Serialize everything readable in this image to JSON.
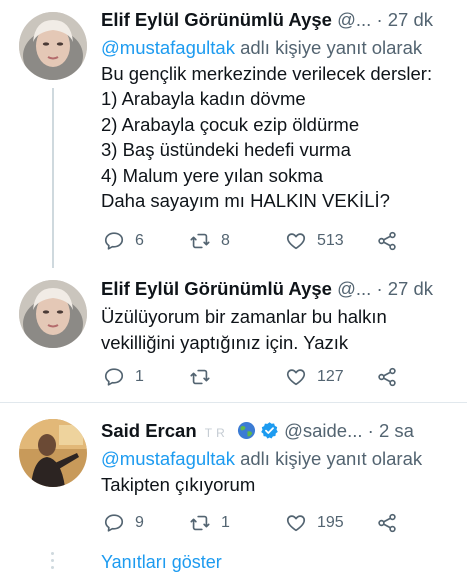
{
  "tweets": [
    {
      "name": "Elif Eylül Görünümlü Ayşe",
      "handle": "@...",
      "dot": "·",
      "time": "27 dk",
      "reply_prefix": "@mustafagultak",
      "reply_suffix": " adlı kişiye yanıt olarak",
      "lines": [
        "Bu gençlik merkezinde verilecek dersler:",
        "1) Arabayla kadın dövme",
        "2) Arabayla çocuk ezip öldürme",
        "3) Baş üstündeki hedefi vurma",
        "4) Malum yere yılan sokma",
        "Daha sayayım mı HALKIN VEKİLİ?"
      ],
      "replies": "6",
      "retweets": "8",
      "likes": "513"
    },
    {
      "name": "Elif Eylül Görünümlü Ayşe",
      "handle": "@...",
      "dot": "·",
      "time": "27 dk",
      "lines": [
        "Üzülüyorum bir zamanlar bu halkın",
        "vekilliğini yaptığınız için. Yazık"
      ],
      "replies": "1",
      "retweets": "",
      "likes": "127"
    },
    {
      "name": "Said Ercan",
      "flag_letters": "TR",
      "handle": "@saide...",
      "dot": "·",
      "time": "2 sa",
      "reply_prefix": "@mustafagultak",
      "reply_suffix": " adlı kişiye yanıt olarak",
      "lines": [
        "Takipten çıkıyorum"
      ],
      "replies": "9",
      "retweets": "1",
      "likes": "195"
    }
  ],
  "show_replies_label": "Yanıtları göster",
  "icons": [
    "reply-icon",
    "retweet-icon",
    "like-icon",
    "share-icon",
    "verified-badge-icon",
    "globe-icon"
  ],
  "colors": {
    "accent": "#1d9bf0",
    "text": "#0f1419",
    "muted": "#536471",
    "thread": "#cfd9de"
  }
}
